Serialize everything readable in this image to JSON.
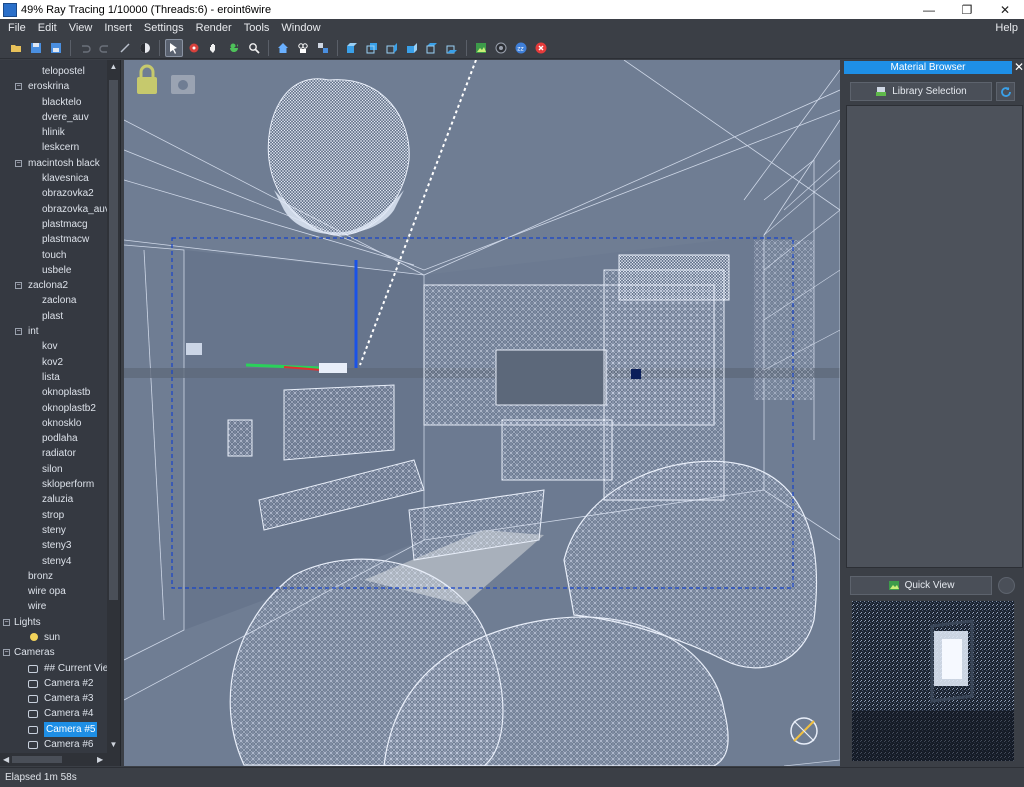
{
  "window": {
    "title": "49% Ray Tracing 1/10000 (Threads:6) - eroint6wire",
    "minimize": "—",
    "maximize": "❐",
    "close": "✕"
  },
  "menu": {
    "items": [
      "File",
      "Edit",
      "View",
      "Insert",
      "Settings",
      "Render",
      "Tools",
      "Window"
    ],
    "help": "Help"
  },
  "toolbar": {
    "icons": [
      "open-icon",
      "save-icon",
      "save-as-icon",
      "undo-icon",
      "redo-icon",
      "link-icon",
      "shading-icon",
      "select-icon",
      "pick-icon",
      "pan-icon",
      "rotate-icon",
      "zoom-icon",
      "home-icon",
      "camera-add-icon",
      "camera-cycle-icon",
      "view-front-icon",
      "view-back-icon",
      "view-left-icon",
      "view-right-icon",
      "view-top-icon",
      "view-bottom-icon",
      "render-icon",
      "settings-icon",
      "sleep-icon",
      "stop-icon"
    ]
  },
  "tree": {
    "items": [
      {
        "label": "telopostel",
        "level": 2
      },
      {
        "label": "eroskrina",
        "level": 1,
        "expanded": true
      },
      {
        "label": "blacktelo",
        "level": 2
      },
      {
        "label": "dvere_auv",
        "level": 2
      },
      {
        "label": "hlinik",
        "level": 2
      },
      {
        "label": "leskcern",
        "level": 2
      },
      {
        "label": "macintosh black",
        "level": 1,
        "expanded": true
      },
      {
        "label": "klavesnica",
        "level": 2
      },
      {
        "label": "obrazovka2",
        "level": 2
      },
      {
        "label": "obrazovka_auv",
        "level": 2
      },
      {
        "label": "plastmacg",
        "level": 2
      },
      {
        "label": "plastmacw",
        "level": 2
      },
      {
        "label": "touch",
        "level": 2
      },
      {
        "label": "usbele",
        "level": 2
      },
      {
        "label": "zaclona2",
        "level": 1,
        "expanded": true
      },
      {
        "label": "zaclona",
        "level": 2
      },
      {
        "label": "plast",
        "level": 2
      },
      {
        "label": "int",
        "level": 1,
        "expanded": true
      },
      {
        "label": "kov",
        "level": 2
      },
      {
        "label": "kov2",
        "level": 2
      },
      {
        "label": "lista",
        "level": 2
      },
      {
        "label": "oknoplastb",
        "level": 2
      },
      {
        "label": "oknoplastb2",
        "level": 2
      },
      {
        "label": "oknosklo",
        "level": 2
      },
      {
        "label": "podlaha",
        "level": 2
      },
      {
        "label": "radiator",
        "level": 2
      },
      {
        "label": "silon",
        "level": 2
      },
      {
        "label": "skloperform",
        "level": 2
      },
      {
        "label": "zaluzia",
        "level": 2
      },
      {
        "label": "strop",
        "level": 2
      },
      {
        "label": "steny",
        "level": 2
      },
      {
        "label": "steny3",
        "level": 2
      },
      {
        "label": "steny4",
        "level": 2
      },
      {
        "label": "bronz",
        "level": 1
      },
      {
        "label": "wire opa",
        "level": 1
      },
      {
        "label": "wire",
        "level": 1
      },
      {
        "label": "Lights",
        "level": 0,
        "expanded": true
      },
      {
        "label": "sun",
        "level": 1,
        "icon": "light-bulb-icon"
      },
      {
        "label": "Cameras",
        "level": 0,
        "expanded": true
      },
      {
        "label": "## Current View",
        "level": 1,
        "icon": "camera-icon"
      },
      {
        "label": "Camera #2",
        "level": 1,
        "icon": "camera-icon"
      },
      {
        "label": "Camera #3",
        "level": 1,
        "icon": "camera-icon"
      },
      {
        "label": "Camera #4",
        "level": 1,
        "icon": "camera-icon"
      },
      {
        "label": "Camera #5",
        "level": 1,
        "icon": "camera-icon",
        "selected": true
      },
      {
        "label": "Camera #6",
        "level": 1,
        "icon": "camera-icon"
      }
    ]
  },
  "right_panel": {
    "header": "Material Browser",
    "close": "✕",
    "library_button": "Library Selection",
    "quick_view_button": "Quick View"
  },
  "status": {
    "text": "Elapsed 1m 58s"
  },
  "colors": {
    "accent": "#1e8fe6",
    "panel": "#3b3f46",
    "viewport": "#6f7d93",
    "wire": "#dfe7f6"
  }
}
